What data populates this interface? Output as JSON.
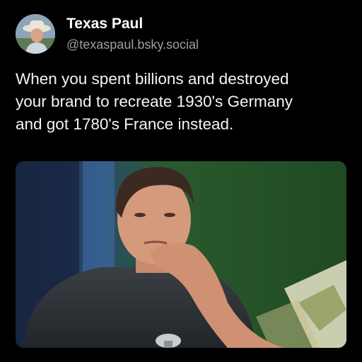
{
  "post": {
    "author": {
      "display_name": "Texas Paul",
      "handle": "@texaspaul.bsky.social",
      "avatar_icon": "user-avatar"
    },
    "text_lines": [
      "When you spent billions and destroyed",
      "your brand to recreate 1930's Germany",
      "and got 1780's France instead."
    ],
    "media": {
      "type": "photo",
      "description_icon": "person-photo"
    }
  },
  "colors": {
    "background": "#000000",
    "text": "#ffffff",
    "handle": "#9aa0a6"
  }
}
